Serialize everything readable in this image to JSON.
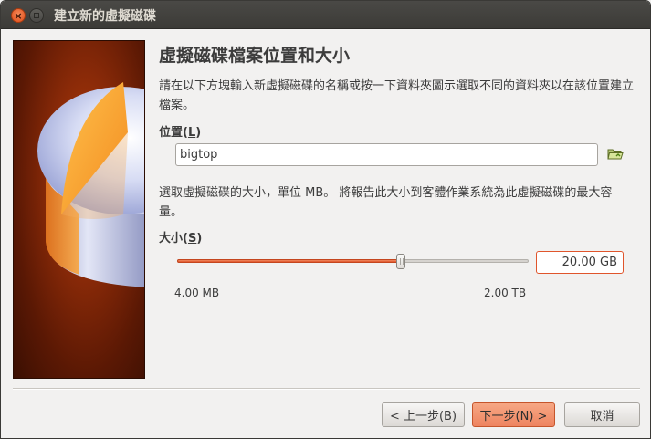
{
  "window": {
    "title": "建立新的虛擬磁碟"
  },
  "page": {
    "heading": "虛擬磁碟檔案位置和大小",
    "location_description": "請在以下方塊輸入新虛擬磁碟的名稱或按一下資料夾圖示選取不同的資料夾以在該位置建立檔案。",
    "location_label": "位置",
    "location_mnemonic": "L",
    "location_value": "bigtop",
    "size_description": "選取虛擬磁碟的大小，單位 MB。 將報告此大小到客體作業系統為此虛擬磁碟的最大容量。",
    "size_label": "大小",
    "size_mnemonic": "S",
    "size_value": "20.00 GB",
    "slider_min_label": "4.00 MB",
    "slider_max_label": "2.00 TB",
    "slider_position_fraction": 0.636
  },
  "buttons": {
    "back": "< 上一步(B)",
    "next": "下一步(N) >",
    "cancel": "取消"
  },
  "icons": {
    "folder": "folder-open-icon",
    "close": "close-icon",
    "maximize": "maximize-icon"
  },
  "colors": {
    "accent": "#e0552c",
    "primary_button": "#f08e68",
    "titlebar": "#3c3b37"
  }
}
